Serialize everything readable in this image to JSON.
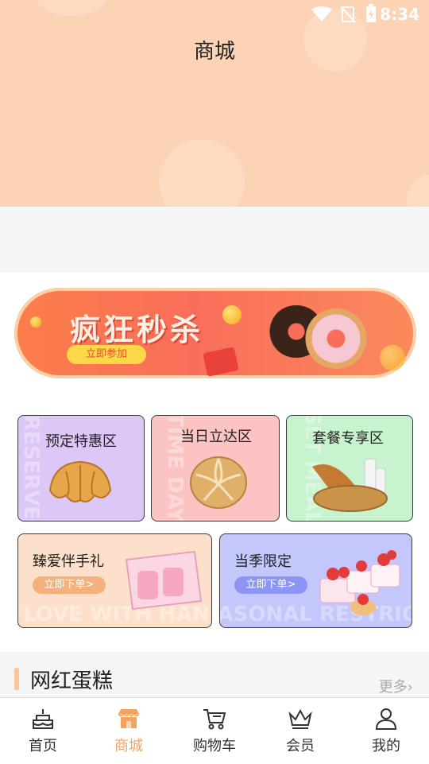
{
  "status_bar": {
    "time": "8:34"
  },
  "header": {
    "title": "商城"
  },
  "flash_sale": {
    "title": "疯狂秒杀",
    "button": "立即参加"
  },
  "tiles": [
    {
      "label": "预定特惠区",
      "ghost": "RESERVE"
    },
    {
      "label": "当日立达区",
      "ghost": "TIME DAY"
    },
    {
      "label": "套餐专享区",
      "ghost": "SET MEAL"
    },
    {
      "label": "臻爱伴手礼",
      "button": "立即下单>",
      "ghost": "LOVE WITH HAND"
    },
    {
      "label": "当季限定",
      "button": "立即下单>",
      "ghost": "SEASONAL RESTRICT"
    }
  ],
  "section": {
    "title": "网红蛋糕",
    "more": "更多"
  },
  "bottom_nav": [
    {
      "label": "首页",
      "icon": "cake-icon",
      "active": false
    },
    {
      "label": "商城",
      "icon": "shop-icon",
      "active": true
    },
    {
      "label": "购物车",
      "icon": "cart-icon",
      "active": false
    },
    {
      "label": "会员",
      "icon": "crown-icon",
      "active": false
    },
    {
      "label": "我的",
      "icon": "user-icon",
      "active": false
    }
  ],
  "colors": {
    "accent": "#f6a35f",
    "header_bg": "#fdd3b6"
  }
}
